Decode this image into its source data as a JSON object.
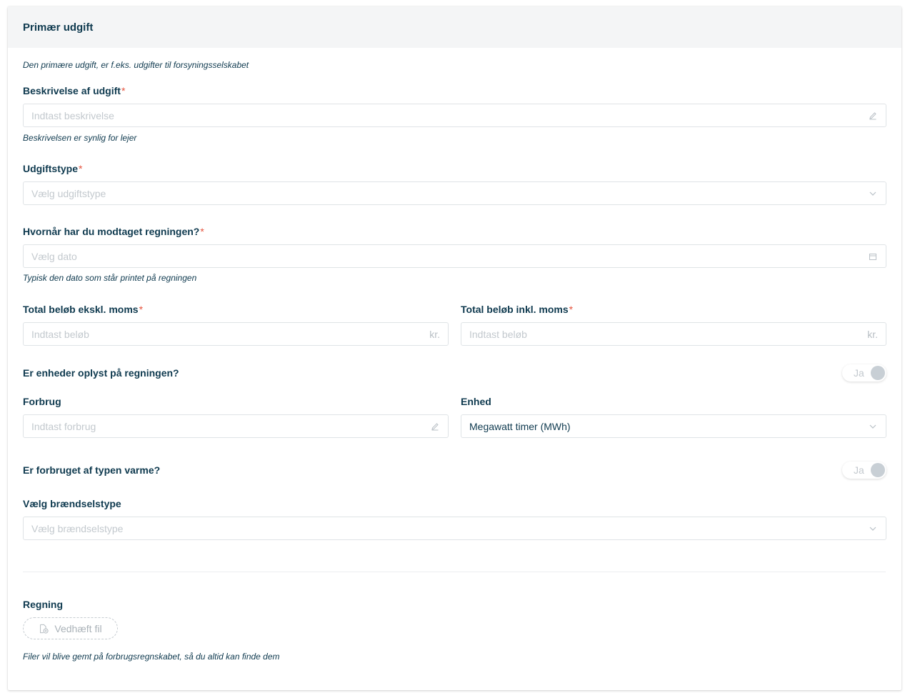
{
  "header": {
    "title": "Primær udgift"
  },
  "intro_note": "Den primære udgift, er f.eks. udgifter til forsyningsselskabet",
  "required_mark": "*",
  "description": {
    "label": "Beskrivelse af udgift",
    "placeholder": "Indtast beskrivelse",
    "help": "Beskrivelsen er synlig for lejer",
    "icon": "pencil-icon"
  },
  "expense_type": {
    "label": "Udgiftstype",
    "placeholder": "Vælg udgiftstype",
    "icon": "chevron-down-icon"
  },
  "received_date": {
    "label": "Hvornår har du modtaget regningen?",
    "placeholder": "Vælg dato",
    "help": "Typisk den dato som står printet på regningen",
    "icon": "calendar-icon"
  },
  "total_excl": {
    "label": "Total beløb ekskl. moms",
    "placeholder": "Indtast beløb",
    "suffix": "kr."
  },
  "total_incl": {
    "label": "Total beløb inkl. moms",
    "placeholder": "Indtast beløb",
    "suffix": "kr."
  },
  "units_toggle": {
    "label": "Er enheder oplyst på regningen?",
    "toggle_label": "Ja",
    "on": false
  },
  "consumption": {
    "label": "Forbrug",
    "placeholder": "Indtast forbrug",
    "icon": "pencil-icon"
  },
  "unit": {
    "label": "Enhed",
    "value": "Megawatt timer (MWh)",
    "icon": "chevron-down-icon"
  },
  "heat_toggle": {
    "label": "Er forbruget af typen varme?",
    "toggle_label": "Ja",
    "on": false
  },
  "fuel_type": {
    "label": "Vælg brændselstype",
    "placeholder": "Vælg brændselstype",
    "icon": "chevron-down-icon"
  },
  "bill": {
    "label": "Regning",
    "attach_label": "Vedhæft fil",
    "attach_icon": "file-add-icon",
    "help": "Filer vil blive gemt på forbrugsregnskabet, så du altid kan finde dem"
  },
  "colors": {
    "text": "#0f3a4f",
    "required": "#e5533d",
    "header_bg": "#f4f5f6",
    "border": "#dfe3e6"
  }
}
